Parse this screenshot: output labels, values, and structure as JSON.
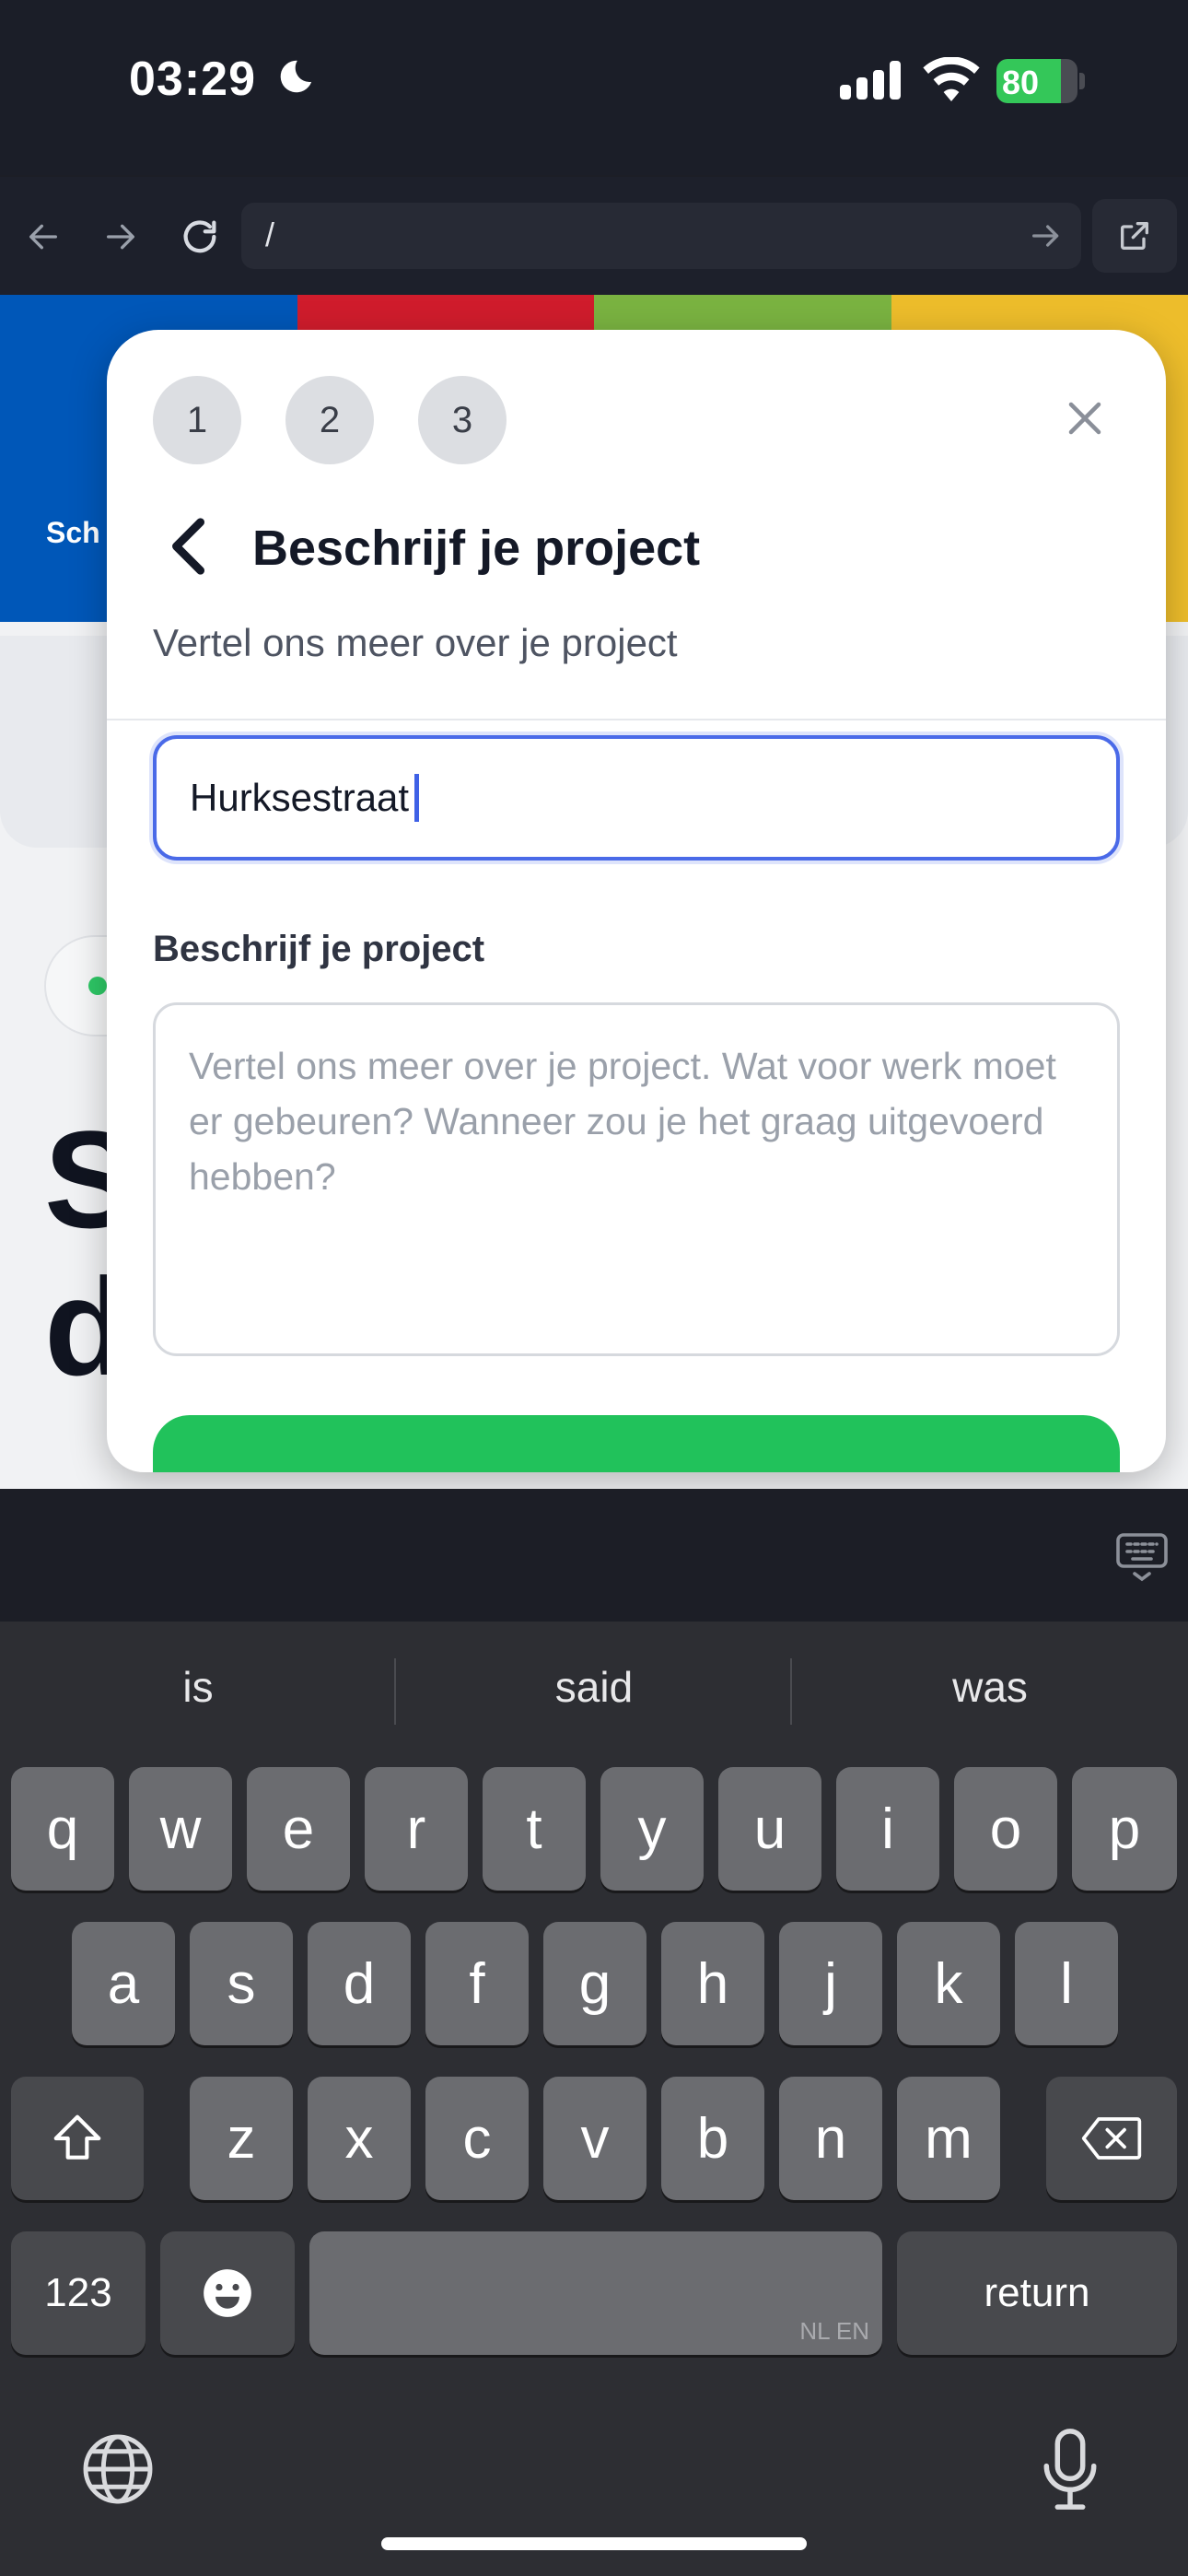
{
  "status_bar": {
    "time": "03:29",
    "battery_percent": "80",
    "battery_level": 0.8,
    "icons": [
      "moon-icon",
      "signal-icon",
      "wifi-icon",
      "battery-charging-icon"
    ]
  },
  "browser": {
    "url": "/",
    "icons": [
      "back-arrow-icon",
      "forward-arrow-icon",
      "reload-icon",
      "go-arrow-icon",
      "open-external-icon"
    ]
  },
  "background_page": {
    "label_fragment": "Sch",
    "heading_line1_fragment": "S",
    "heading_line2_fragment": "d",
    "stripe_colors": [
      "#0057b8",
      "#d01c2c",
      "#7ab341",
      "#edbd2b"
    ]
  },
  "modal": {
    "steps": [
      "1",
      "2",
      "3"
    ],
    "title": "Beschrijf je project",
    "subtitle": "Vertel ons meer over je project",
    "address_value": "Hurksestraat",
    "description_label": "Beschrijf je project",
    "description_placeholder": "Vertel ons meer over je project. Wat voor werk moet er gebeuren? Wanneer zou je het graag uitgevoerd hebben?",
    "accent_color": "#21c25b",
    "focus_color": "#4a6ae8"
  },
  "keyboard": {
    "predictions": [
      "is",
      "said",
      "was"
    ],
    "row1": [
      "q",
      "w",
      "e",
      "r",
      "t",
      "y",
      "u",
      "i",
      "o",
      "p"
    ],
    "row2": [
      "a",
      "s",
      "d",
      "f",
      "g",
      "h",
      "j",
      "k",
      "l"
    ],
    "row3": [
      "z",
      "x",
      "c",
      "v",
      "b",
      "n",
      "m"
    ],
    "numbers_label": "123",
    "return_label": "return",
    "space_languages": "NL EN"
  }
}
